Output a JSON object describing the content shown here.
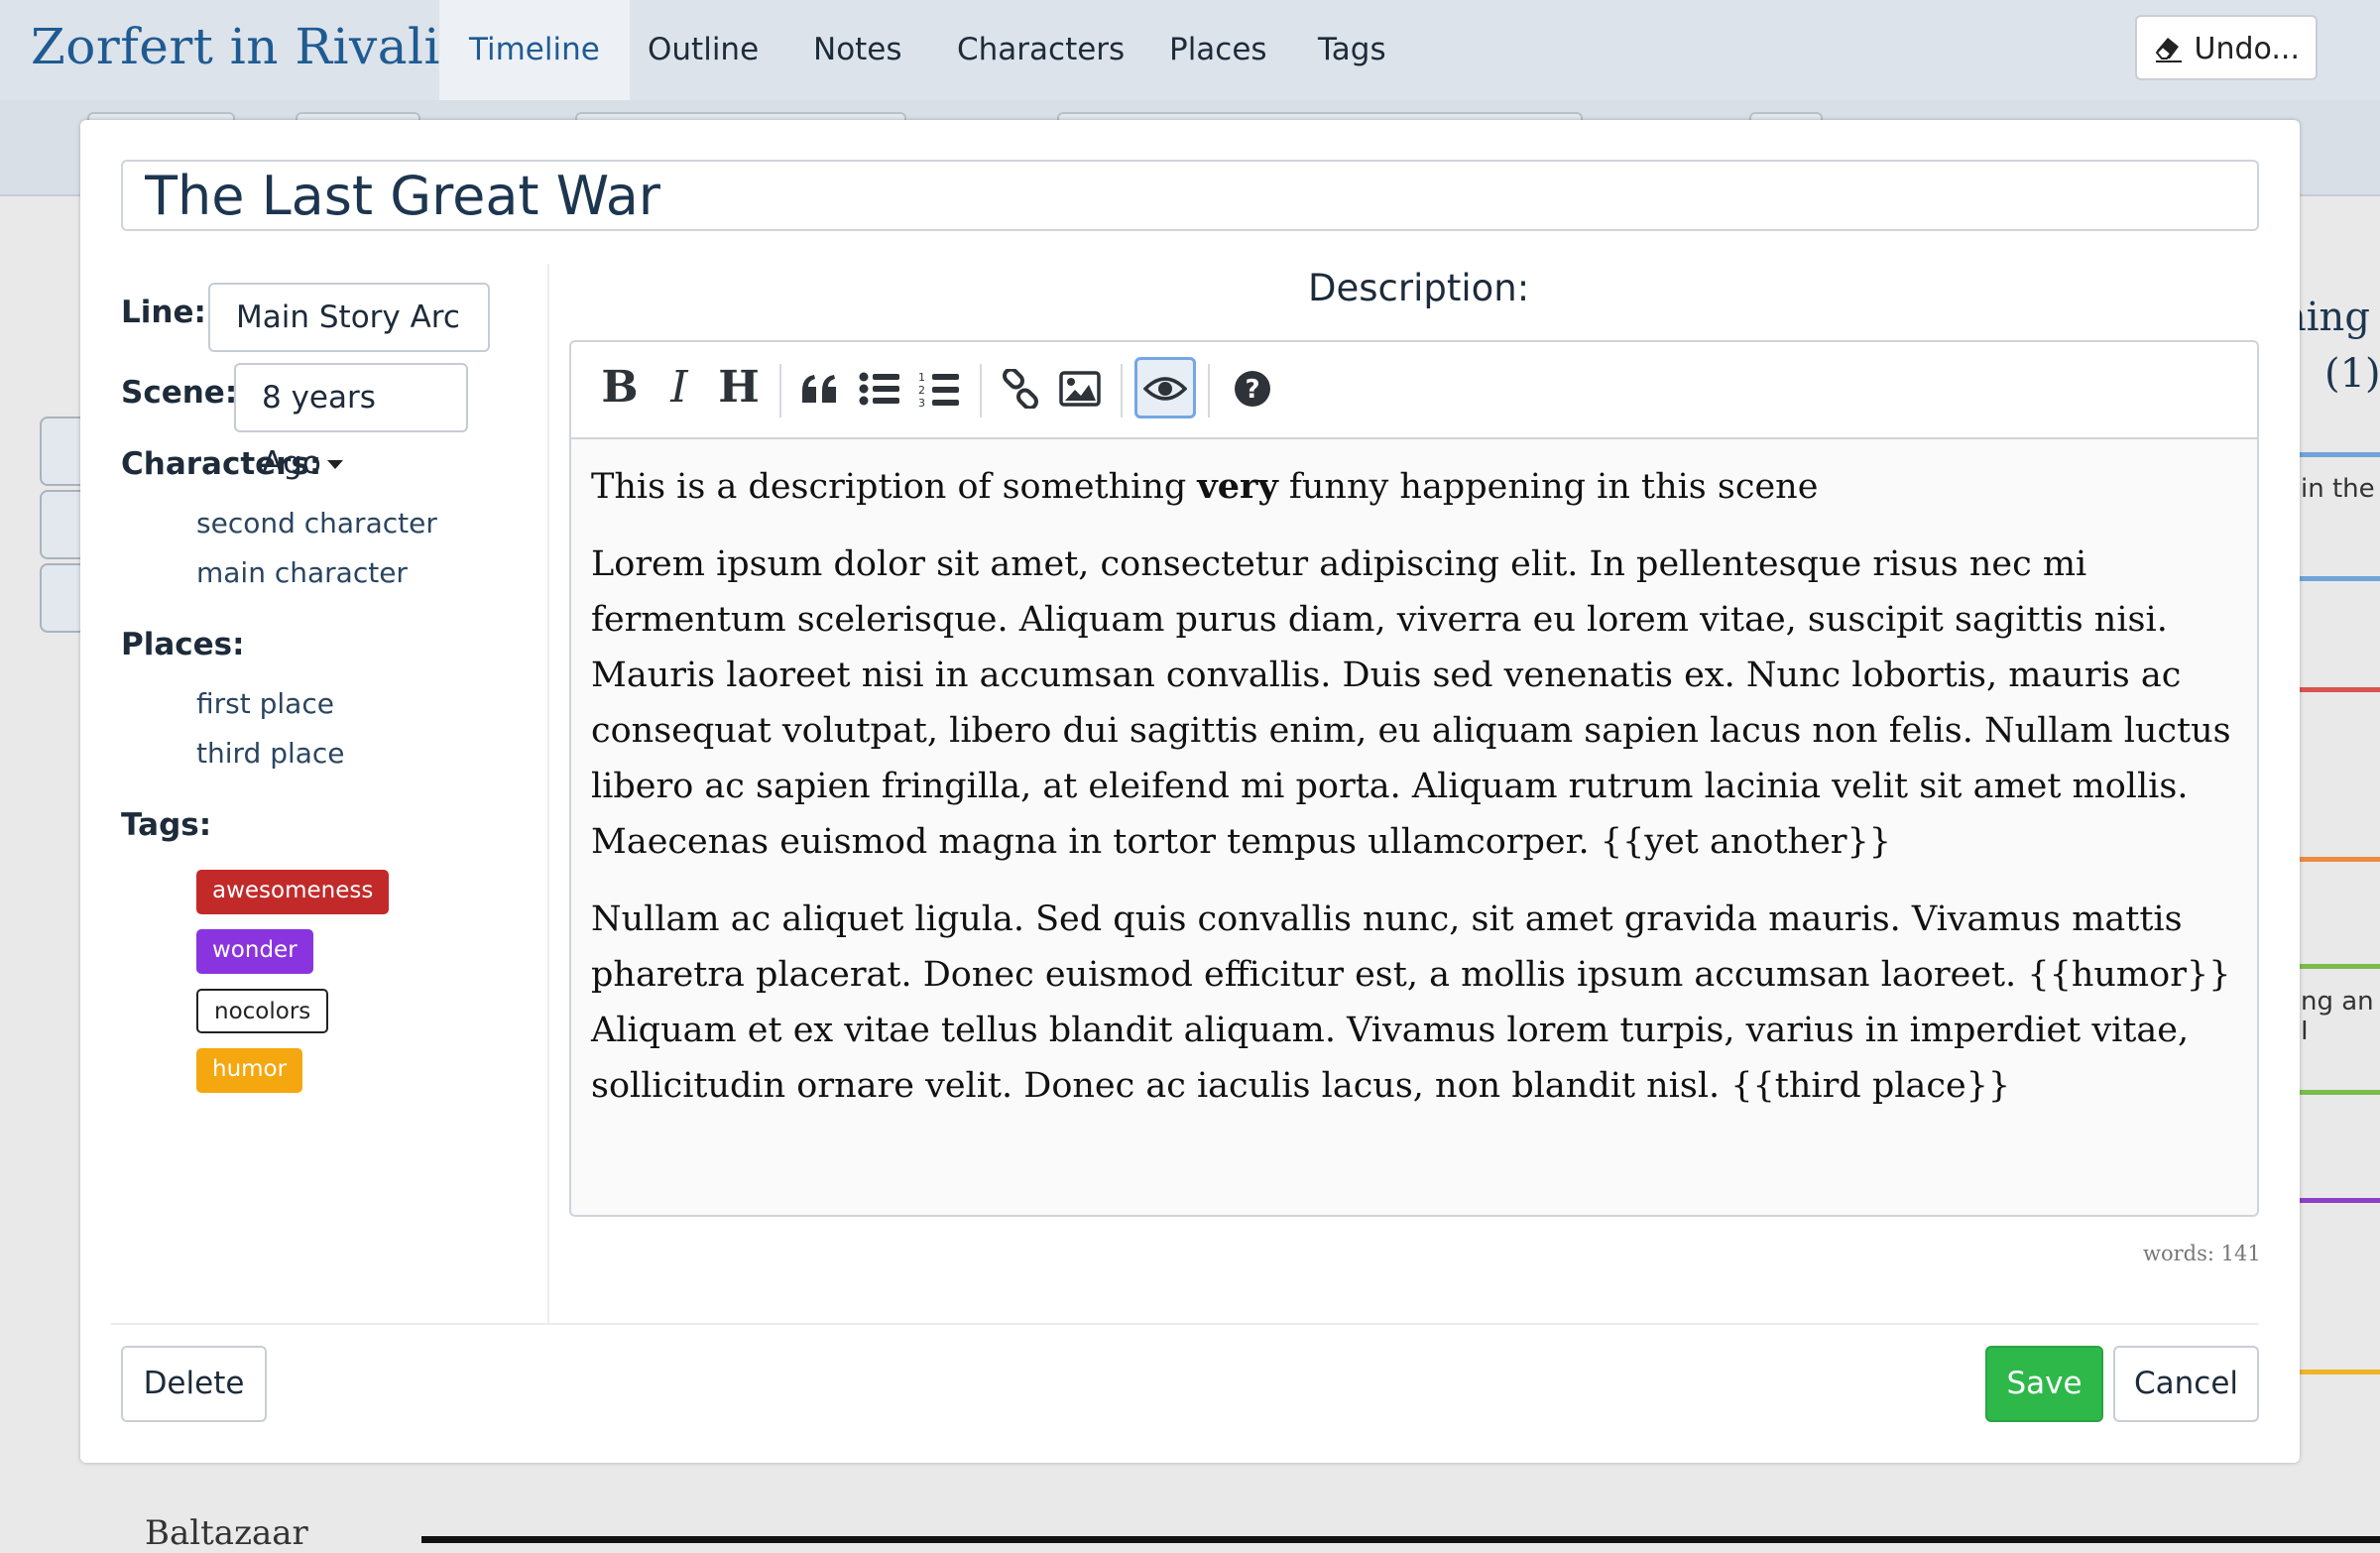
{
  "app": {
    "brand": "Zorfert in Rivalia"
  },
  "nav": {
    "tabs": [
      "Timeline",
      "Outline",
      "Notes",
      "Characters",
      "Places",
      "Tags"
    ],
    "active": "Timeline",
    "undo_label": "Undo..."
  },
  "background": {
    "title_fragment": "ning",
    "count_fragment": "(1)",
    "text_fragment_1": "in the",
    "text_fragment_2": "ng an I",
    "name_fragment": "Baltazaar",
    "line_colors": [
      "#6fa4d8",
      "#6fa4d8",
      "#d9534f",
      "#ee8a42",
      "#7bbd4a",
      "#7bbd4a",
      "#8e3fc6",
      "#f0b429"
    ]
  },
  "modal": {
    "title": "The Last Great War",
    "line_label": "Line:",
    "line_value": "Main Story Arc",
    "scene_label": "Scene:",
    "scene_value": "8 years Ago",
    "characters_label": "Characters:",
    "characters": [
      "second character",
      "main character"
    ],
    "places_label": "Places:",
    "places": [
      "first place",
      "third place"
    ],
    "tags_label": "Tags:",
    "tags": [
      {
        "name": "awesomeness",
        "color": "#c22a2a",
        "text_color": "#ffffff"
      },
      {
        "name": "wonder",
        "color": "#8a34e0",
        "text_color": "#ffffff"
      },
      {
        "name": "nocolors",
        "color": "#ffffff",
        "text_color": "#222222"
      },
      {
        "name": "humor",
        "color": "#f5a70f",
        "text_color": "#ffffff"
      }
    ],
    "description_label": "Description:",
    "toolbar_icons": [
      "bold-icon",
      "italic-icon",
      "heading-icon",
      "quote-icon",
      "unordered-list-icon",
      "ordered-list-icon",
      "link-icon",
      "image-icon",
      "preview-eye-icon",
      "help-icon"
    ],
    "description": {
      "p1_before": "This is a description of something ",
      "p1_bold": "very",
      "p1_after": " funny happening in this scene",
      "p2": "Lorem ipsum dolor sit amet, consectetur adipiscing elit. In pellentesque risus nec mi fermentum scelerisque. Aliquam purus diam, viverra eu lorem vitae, suscipit sagittis nisi. Mauris laoreet nisi in accumsan convallis. Duis sed venenatis ex. Nunc lobortis, mauris ac consequat volutpat, libero dui sagittis enim, eu aliquam sapien lacus non felis. Nullam luctus libero ac sapien fringilla, at eleifend mi porta. Aliquam rutrum lacinia velit sit amet mollis. Maecenas euismod magna in tortor tempus ullamcorper. {{yet another}}",
      "p3": "Nullam ac aliquet ligula. Sed quis convallis nunc, sit amet gravida mauris. Vivamus mattis pharetra placerat. Donec euismod efficitur est, a mollis ipsum accumsan laoreet. {{humor}} Aliquam et ex vitae tellus blandit aliquam. Vivamus lorem turpis, varius in imperdiet vitae, sollicitudin ornare velit. Donec ac iaculis lacus, non blandit nisl. {{third place}}"
    },
    "word_count": "words: 141",
    "delete_label": "Delete",
    "save_label": "Save",
    "cancel_label": "Cancel"
  }
}
